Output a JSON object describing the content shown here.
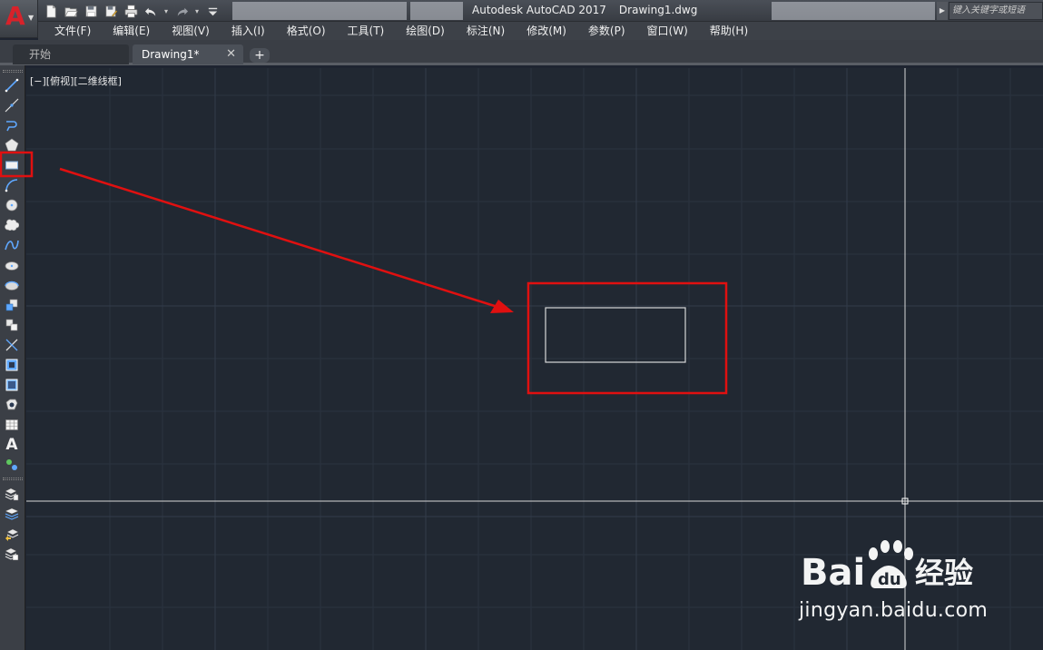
{
  "app": {
    "title": "Autodesk AutoCAD 2017",
    "filename": "Drawing1.dwg",
    "search_placeholder": "键入关键字或短语"
  },
  "quick_access": [
    "new-icon",
    "open-icon",
    "save-icon",
    "save-as-icon",
    "print-icon",
    "undo-icon",
    "redo-icon",
    "customize-icon"
  ],
  "menu": [
    "文件(F)",
    "编辑(E)",
    "视图(V)",
    "插入(I)",
    "格式(O)",
    "工具(T)",
    "绘图(D)",
    "标注(N)",
    "修改(M)",
    "参数(P)",
    "窗口(W)",
    "帮助(H)"
  ],
  "tabs": {
    "start": "开始",
    "drawing": "Drawing1*",
    "close": "✕",
    "add": "+"
  },
  "draw_tools": [
    "line-icon",
    "construction-line-icon",
    "polyline-icon",
    "polygon-icon",
    "rectangle-icon",
    "arc-icon",
    "circle-icon",
    "revision-cloud-icon",
    "spline-icon",
    "ellipse-icon",
    "ellipse-arc-icon",
    "insert-block-icon",
    "make-block-icon",
    "point-icon",
    "hatch-icon",
    "gradient-icon",
    "region-icon",
    "table-icon",
    "multiline-text-icon",
    "add-selected-icon"
  ],
  "layer_tools": [
    "layer-properties-icon",
    "layer-icon",
    "layer-previous-icon",
    "layer-states-icon"
  ],
  "viewport": {
    "label": "[−][俯视][二维线框]"
  },
  "watermark": {
    "brand": "Bai du 经验",
    "url": "jingyan.baidu.com"
  },
  "colors": {
    "canvas": "#212832",
    "annotation": "#e01010",
    "geometry": "#d8d8d8"
  }
}
